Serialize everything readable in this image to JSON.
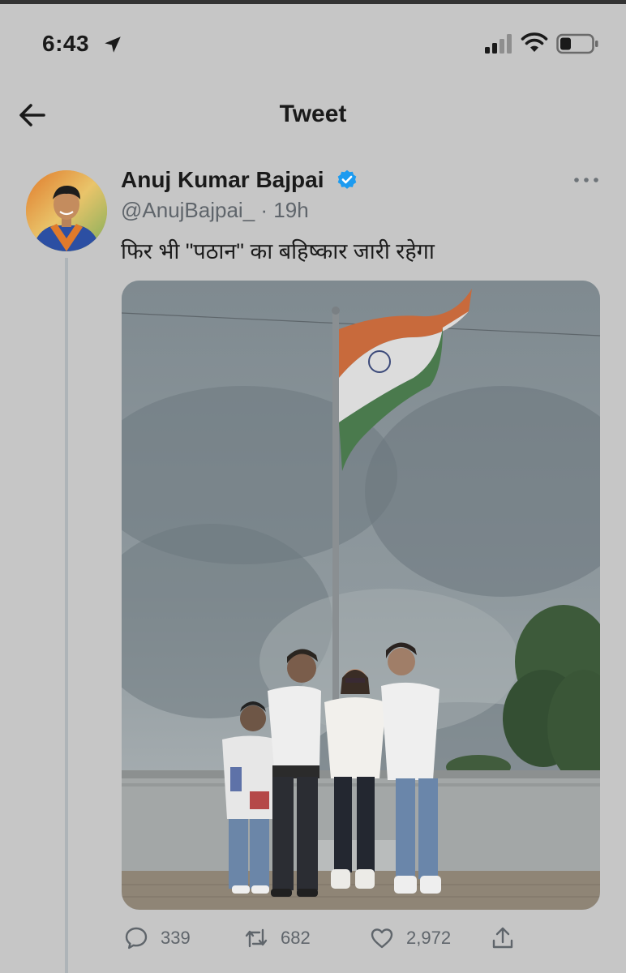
{
  "status_bar": {
    "time": "6:43"
  },
  "nav": {
    "title": "Tweet"
  },
  "tweet": {
    "author_name": "Anuj Kumar Bajpai",
    "handle": "@AnujBajpai_",
    "time_ago": "· 19h",
    "text": "फिर भी \"पठान\" का बहिष्कार जारी रहेगा",
    "stats": {
      "replies": "339",
      "retweets": "682",
      "likes": "2,972"
    }
  },
  "colors": {
    "background": "#c6c6c6",
    "verified": "#1d9bf0",
    "secondary_text": "#5f656b"
  },
  "icons": [
    "location-arrow-icon",
    "signal-icon",
    "wifi-icon",
    "battery-icon",
    "back-arrow-icon",
    "verified-badge-icon",
    "more-options-icon",
    "reply-icon",
    "retweet-icon",
    "like-icon",
    "share-icon"
  ]
}
